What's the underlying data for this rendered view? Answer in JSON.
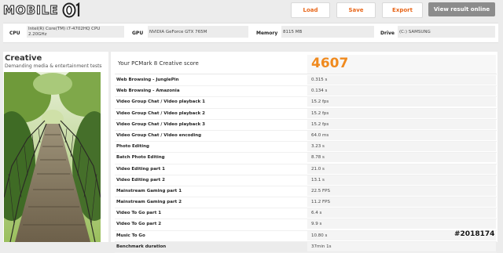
{
  "logo": {
    "text": "MOBILE",
    "mark": "01"
  },
  "toolbar": {
    "load_label": "Load",
    "save_label": "Save",
    "export_label": "Export",
    "online_label": "View result online",
    "accent": "#e8671b"
  },
  "system": {
    "cpu_label": "CPU",
    "cpu_value_1": "Intel(R) Core(TM) i7-4702HQ CPU",
    "cpu_value_2": "2.20GHz",
    "gpu_label": "GPU",
    "gpu_value": "NVIDIA GeForce GTX 765M",
    "memory_label": "Memory",
    "memory_value": "8115 MB",
    "drive_label": "Drive",
    "drive_value": "(C:) SAMSUNG"
  },
  "left": {
    "title": "Creative",
    "subtitle": "Demanding media & entertainment tests"
  },
  "score": {
    "label": "Your PCMark 8 Creative score",
    "value": "4607",
    "color": "#f08a1e"
  },
  "results": [
    {
      "name": "Web Browsing - JunglePin",
      "value": "0.315 s"
    },
    {
      "name": "Web Browsing - Amazonia",
      "value": "0.134 s"
    },
    {
      "name": "Video Group Chat / Video playback 1",
      "value": "15.2 fps"
    },
    {
      "name": "Video Group Chat / Video playback 2",
      "value": "15.2 fps"
    },
    {
      "name": "Video Group Chat / Video playback 3",
      "value": "15.2 fps"
    },
    {
      "name": "Video Group Chat / Video encoding",
      "value": "64.0 ms"
    },
    {
      "name": "Photo Editing",
      "value": "3.23 s"
    },
    {
      "name": "Batch Photo Editing",
      "value": "8.78 s"
    },
    {
      "name": "Video Editing part 1",
      "value": "21.0 s"
    },
    {
      "name": "Video Editing part 2",
      "value": "13.1 s"
    },
    {
      "name": "Mainstream Gaming part 1",
      "value": "22.5 FPS"
    },
    {
      "name": "Mainstream Gaming part 2",
      "value": "11.2 FPS"
    },
    {
      "name": "Video To Go part 1",
      "value": "6.4 s"
    },
    {
      "name": "Video To Go part 2",
      "value": "9.9 s"
    },
    {
      "name": "Music To Go",
      "value": "10.80 s"
    },
    {
      "name": "Benchmark duration",
      "value": "37min 1s"
    }
  ],
  "watermark": "#2018174"
}
